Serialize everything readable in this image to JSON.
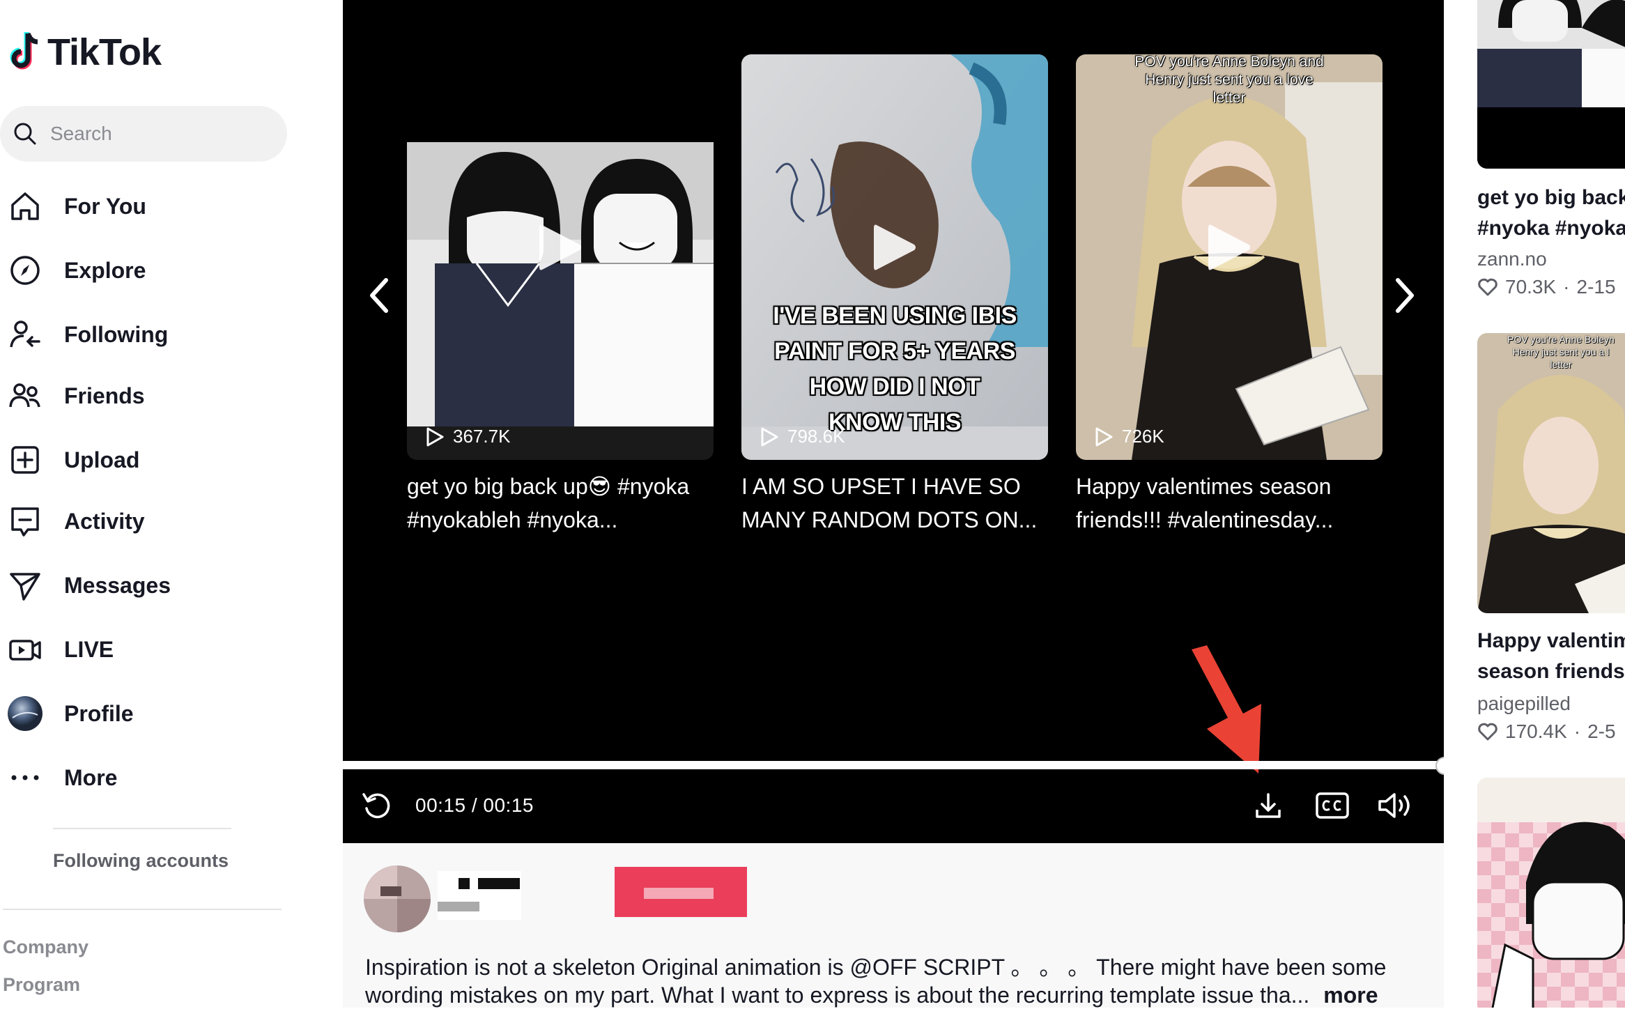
{
  "app": {
    "name": "TikTok"
  },
  "search": {
    "placeholder": "Search"
  },
  "nav": {
    "items": [
      {
        "label": "For You",
        "icon": "home-icon"
      },
      {
        "label": "Explore",
        "icon": "compass-icon"
      },
      {
        "label": "Following",
        "icon": "following-icon"
      },
      {
        "label": "Friends",
        "icon": "friends-icon"
      },
      {
        "label": "Upload",
        "icon": "upload-icon"
      },
      {
        "label": "Activity",
        "icon": "activity-icon"
      },
      {
        "label": "Messages",
        "icon": "messages-icon"
      },
      {
        "label": "LIVE",
        "icon": "live-icon"
      },
      {
        "label": "Profile",
        "icon": "profile-avatar"
      },
      {
        "label": "More",
        "icon": "more-icon"
      }
    ],
    "following_accounts": "Following accounts",
    "footer": [
      "Company",
      "Program"
    ]
  },
  "player": {
    "recommendations": [
      {
        "views": "367.7K",
        "title_line1": "get yo big back up😎 #nyoka",
        "title_line2": "#nyokableh #nyoka..."
      },
      {
        "views": "798.6K",
        "title_line1": "I AM SO UPSET I HAVE SO",
        "title_line2": "MANY RANDOM DOTS ON...",
        "overlay_lines": [
          "I'VE BEEN USING IBIS",
          "PAINT FOR 5+ YEARS",
          "HOW DID I NOT",
          "KNOW THIS"
        ]
      },
      {
        "views": "726K",
        "title_line1": "Happy valentimes season",
        "title_line2": "friends!!! #valentinesday...",
        "overlay_lines": [
          "POV you're Anne Boleyn and",
          "Henry just sent you a love",
          "letter"
        ]
      }
    ],
    "progress": 1.0,
    "time": "00:15 / 00:15",
    "controls": [
      "replay-icon",
      "download-icon",
      "captions-icon",
      "volume-icon"
    ],
    "accent": "#fe2c55"
  },
  "description": {
    "text_line1": "Inspiration is not a skeleton Original animation is @OFF SCRIPT 。 。 。 There might have been some",
    "text_line2": "wording mistakes on my part. What I want to express is about the recurring template issue tha...",
    "more": "more"
  },
  "right_column": {
    "items": [
      {
        "title_line1": "get yo big back",
        "title_line2": "#nyoka #nyoka",
        "author": "zann.no",
        "likes": "70.3K",
        "date": "2-15"
      },
      {
        "title_line1": "Happy valentim",
        "title_line2": "season friends!",
        "author": "paigepilled",
        "likes": "170.4K",
        "date": "2-5",
        "overlay_lines": [
          "POV you're Anne Boleyn",
          "Henry just sent you a l",
          "letter"
        ]
      }
    ],
    "separator": "·"
  }
}
